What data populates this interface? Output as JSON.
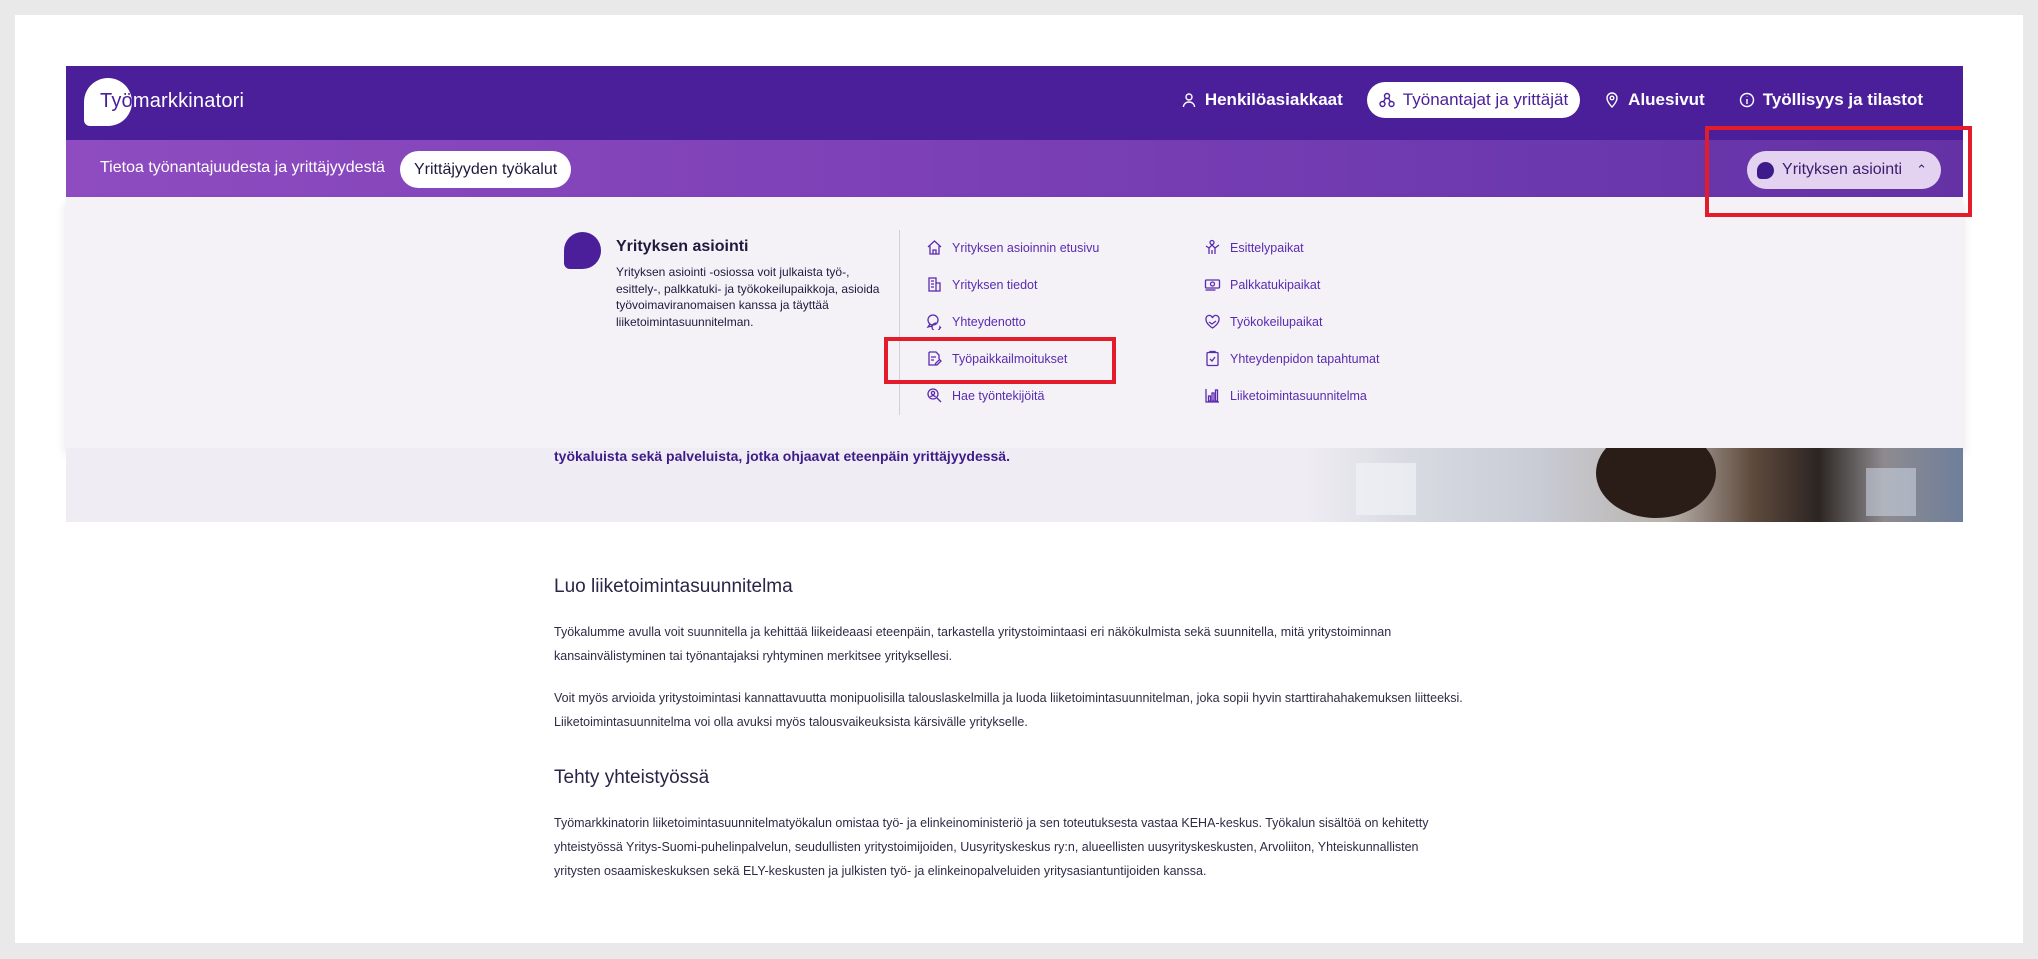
{
  "logo": {
    "text_tyo": "Työ",
    "text_rest": "markkinatori"
  },
  "topnav": [
    {
      "label": "Henkilöasiakkaat",
      "icon": "person-icon",
      "active": false
    },
    {
      "label": "Työnantajat ja yrittäjät",
      "icon": "network-icon",
      "active": true
    },
    {
      "label": "Aluesivut",
      "icon": "location-pin-icon",
      "active": false
    },
    {
      "label": "Työllisyys ja tilastot",
      "icon": "info-circle-icon",
      "active": false
    }
  ],
  "subbar": {
    "label": "Tietoa työnantajuudesta ja yrittäjyydestä",
    "pill": "Yrittäjyyden työkalut",
    "company_button": "Yrityksen asiointi"
  },
  "mega": {
    "title": "Yrityksen asiointi",
    "text": "Yrityksen asiointi -osiossa voit julkaista työ-, esittely-, palkkatuki- ja työkokeilupaikkoja, asioida työvoimaviranomaisen kanssa ja täyttää liiketoimintasuunnitelman.",
    "col1": [
      {
        "label": "Yrityksen asioinnin etusivu",
        "icon": "home-icon"
      },
      {
        "label": "Yrityksen tiedot",
        "icon": "building-icon"
      },
      {
        "label": "Yhteydenotto",
        "icon": "chat-icon"
      },
      {
        "label": "Työpaikkailmoitukset",
        "icon": "document-edit-icon"
      },
      {
        "label": "Hae työntekijöitä",
        "icon": "search-person-icon"
      }
    ],
    "col2": [
      {
        "label": "Esittelypaikat",
        "icon": "presenter-icon"
      },
      {
        "label": "Palkkatukipaikat",
        "icon": "money-icon"
      },
      {
        "label": "Työkokeilupaikat",
        "icon": "handshake-heart-icon"
      },
      {
        "label": "Yhteydenpidon tapahtumat",
        "icon": "clipboard-check-icon"
      },
      {
        "label": "Liiketoimintasuunnitelma",
        "icon": "chart-icon"
      }
    ]
  },
  "hero": {
    "text": "työkaluista sekä palveluista, jotka ohjaavat eteenpäin yrittäjyydessä."
  },
  "content": {
    "h1": "Luo liiketoimintasuunnitelma",
    "p1a": "Työkalumme avulla voit suunnitella ja kehittää liikeideaasi eteenpäin, tarkastella yritystoimintaasi eri näkökulmista sekä suunnitella, mitä yritystoiminnan",
    "p1b": "kansainvälistyminen tai työnantajaksi ryhtyminen merkitsee yrityksellesi.",
    "p2a": "Voit myös arvioida yritystoimintasi kannattavuutta monipuolisilla talouslaskelmilla ja luoda liiketoimintasuunnitelman, joka sopii hyvin starttirahahakemuksen liitteeksi.",
    "p2b": "Liiketoimintasuunnitelma voi olla avuksi myös talousvaikeuksista kärsivälle yritykselle.",
    "h2": "Tehty yhteistyössä",
    "p3a": "Työmarkkinatorin liiketoimintasuunnitelmatyökalun omistaa työ- ja elinkeinoministeriö ja sen toteutuksesta vastaa KEHA-keskus. Työkalun sisältöä on kehitetty",
    "p3b": "yhteistyössä Yritys-Suomi-puhelinpalvelun, seudullisten yritystoimijoiden, Uusyrityskeskus ry:n, alueellisten uusyrityskeskusten, Arvoliiton, Yhteiskunnallisten",
    "p3c": "yritysten osaamiskeskuksen sekä ELY-keskusten ja julkisten työ- ja elinkeinopalveluiden yritysasiantuntijoiden kanssa."
  },
  "colors": {
    "brand": "#4b1f9a",
    "link": "#5a2bb0",
    "annotation": "#e21c2a"
  }
}
